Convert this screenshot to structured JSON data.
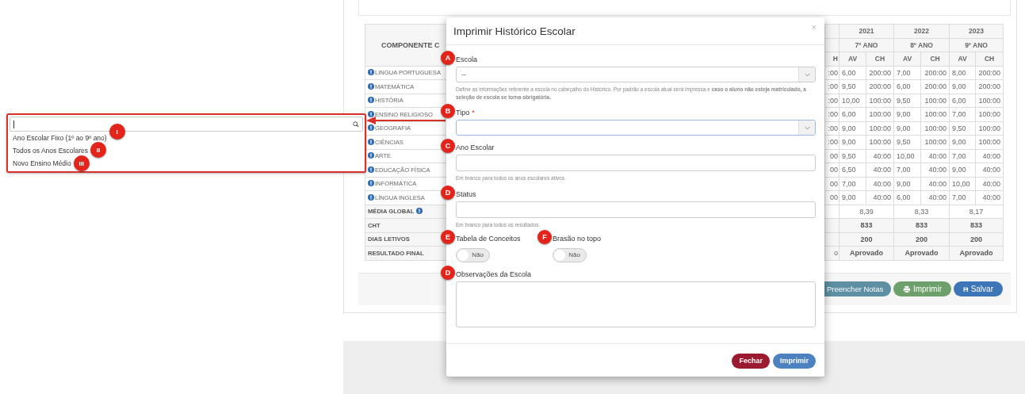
{
  "table": {
    "component_header": "COMPONENTE C",
    "cut_header": "H",
    "years": [
      {
        "year": "2021",
        "grade": "7º ANO",
        "columns": [
          "AV",
          "CH"
        ]
      },
      {
        "year": "2022",
        "grade": "8º ANO",
        "columns": [
          "AV",
          "CH"
        ]
      },
      {
        "year": "2023",
        "grade": "9º ANO",
        "columns": [
          "AV",
          "CH"
        ]
      }
    ],
    "rows": [
      {
        "kind": "subject",
        "label": "LINGUA PORTUGUESA",
        "cut": ":00",
        "values": [
          "6,00",
          "200:00",
          "7,00",
          "200:00",
          "8,00",
          "200:00"
        ]
      },
      {
        "kind": "subject",
        "label": "MATEMÁTICA",
        "cut": ":00",
        "values": [
          "9,50",
          "200:00",
          "6,00",
          "200:00",
          "9,00",
          "200:00"
        ]
      },
      {
        "kind": "subject",
        "label": "HISTÓRIA",
        "cut": ":00",
        "values": [
          "10,00",
          "100:00",
          "9,50",
          "100:00",
          "6,00",
          "100:00"
        ]
      },
      {
        "kind": "subject",
        "label": "ENSINO RELIGIOSO",
        "cut": ":00",
        "values": [
          "6,00",
          "100:00",
          "9,00",
          "100:00",
          "7,00",
          "100:00"
        ]
      },
      {
        "kind": "subject",
        "label": "GEOGRAFIA",
        "cut": ":00",
        "values": [
          "9,00",
          "100:00",
          "9,00",
          "100:00",
          "9,50",
          "100:00"
        ]
      },
      {
        "kind": "subject",
        "label": "CIÊNCIAS",
        "cut": ":00",
        "values": [
          "9,00",
          "100:00",
          "9,50",
          "100:00",
          "9,00",
          "100:00"
        ]
      },
      {
        "kind": "subject",
        "label": "ARTE",
        "cut": "00",
        "values": [
          "9,50",
          "40:00",
          "10,00",
          "40:00",
          "7,00",
          "40:00"
        ]
      },
      {
        "kind": "subject",
        "label": "EDUCAÇÃO FÍSICA",
        "cut": "00",
        "values": [
          "6,50",
          "40:00",
          "7,00",
          "40:00",
          "9,00",
          "40:00"
        ]
      },
      {
        "kind": "subject",
        "label": "INFORMÁTICA",
        "cut": "00",
        "values": [
          "7,00",
          "40:00",
          "9,00",
          "40:00",
          "10,00",
          "40:00"
        ]
      },
      {
        "kind": "subject",
        "label": "LÍNGUA INGLESA",
        "cut": "00",
        "values": [
          "9,00",
          "40:00",
          "6,00",
          "40:00",
          "7,00",
          "40:00"
        ]
      },
      {
        "kind": "average",
        "label": "MÉDIA GLOBAL",
        "values": [
          "8,39",
          "8,33",
          "8,17"
        ]
      },
      {
        "kind": "total",
        "label": "CHT",
        "values": [
          "833",
          "833",
          "833"
        ]
      },
      {
        "kind": "total",
        "label": "DIAS LETIVOS",
        "values": [
          "200",
          "200",
          "200"
        ]
      },
      {
        "kind": "total",
        "label": "RESULTADO FINAL",
        "cut": "o",
        "values": [
          "Aprovado",
          "Aprovado",
          "Aprovado"
        ]
      }
    ]
  },
  "page_buttons": [
    {
      "kind": "fill",
      "label": "Preencher Notas"
    },
    {
      "kind": "print",
      "label": "Imprimir"
    },
    {
      "kind": "save",
      "label": "Salvar"
    }
  ],
  "dropdown": {
    "options": [
      {
        "label": "Ano Escolar Fixo (1º ao 9º ano)",
        "marker": "I"
      },
      {
        "label": "Todos os Anos Escolares",
        "marker": "II"
      },
      {
        "label": "Novo Ensino Médio",
        "marker": "III"
      }
    ]
  },
  "modal": {
    "title": "Imprimir Histórico Escolar",
    "close": "×",
    "fields": [
      {
        "kind": "select",
        "label": "Escola",
        "marker": "A",
        "value": "--",
        "focused": false,
        "help": "Define as informações referente a escola no cabeçalho do Histórico. Por padrão a escola atual será impressa e **caso o aluno não esteja matriculado, a seleção de escola se torna obrigatória.**"
      },
      {
        "kind": "select",
        "label": "Tipo",
        "required_mark": "*",
        "marker": "B",
        "focused": true
      },
      {
        "kind": "input",
        "label": "Ano Escolar",
        "marker": "C",
        "help": "Em branco para todos os anos escolares ativos."
      },
      {
        "kind": "input",
        "label": "Status",
        "marker": "D",
        "help": "Em branco para todos os resultados."
      },
      {
        "kind": "toggles",
        "items": [
          {
            "label": "Tabela de Conceitos",
            "marker": "E",
            "on": false,
            "text": "Não"
          },
          {
            "label": "Brasão no topo",
            "marker": "F",
            "on": false,
            "text": "Não"
          }
        ]
      },
      {
        "kind": "textarea",
        "label": "Observações da Escola",
        "marker": "D"
      }
    ],
    "buttons": [
      {
        "kind": "close",
        "label": "Fechar"
      },
      {
        "kind": "print",
        "label": "Imprimir"
      }
    ]
  }
}
